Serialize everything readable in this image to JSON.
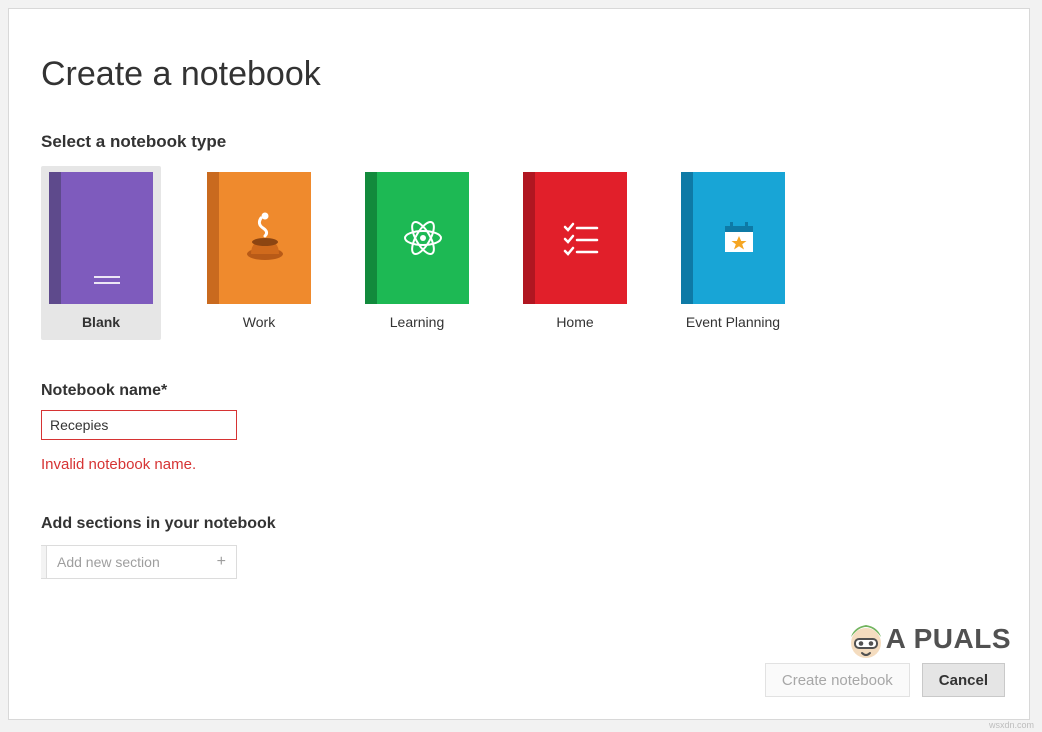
{
  "dialog": {
    "title": "Create a notebook",
    "select_label": "Select a notebook type"
  },
  "types": [
    {
      "key": "blank",
      "label": "Blank",
      "selected": true
    },
    {
      "key": "work",
      "label": "Work",
      "selected": false
    },
    {
      "key": "learning",
      "label": "Learning",
      "selected": false
    },
    {
      "key": "home",
      "label": "Home",
      "selected": false
    },
    {
      "key": "event",
      "label": "Event Planning",
      "selected": false
    }
  ],
  "name_field": {
    "label": "Notebook name*",
    "value": "Recepies",
    "error": "Invalid notebook name."
  },
  "sections": {
    "heading": "Add sections in your notebook",
    "add_placeholder": "Add new section",
    "add_icon": "+"
  },
  "footer": {
    "create_label": "Create notebook",
    "create_enabled": false,
    "cancel_label": "Cancel"
  },
  "watermark": {
    "text": "A  PUALS",
    "url": "wsxdn.com"
  },
  "colors": {
    "error": "#d63333",
    "blank": {
      "spine": "#5e4a8c",
      "cover": "#7e5bbd"
    },
    "work": {
      "spine": "#c96a1f",
      "cover": "#ef8a2d"
    },
    "learning": {
      "spine": "#128a3c",
      "cover": "#1db954"
    },
    "home": {
      "spine": "#b01621",
      "cover": "#e11f2a"
    },
    "event": {
      "spine": "#0e7aa6",
      "cover": "#18a5d6"
    }
  }
}
